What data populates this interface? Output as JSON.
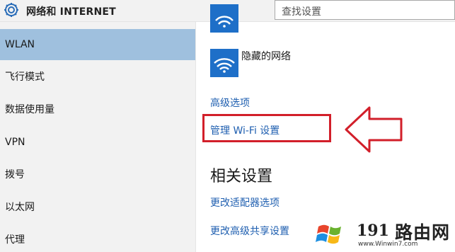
{
  "header": {
    "title": "网络和 INTERNET",
    "search_placeholder": "查找设置"
  },
  "sidebar": {
    "items": [
      {
        "label": "WLAN",
        "active": true
      },
      {
        "label": "飞行模式"
      },
      {
        "label": "数据使用量"
      },
      {
        "label": "VPN"
      },
      {
        "label": "拨号"
      },
      {
        "label": "以太网"
      },
      {
        "label": "代理"
      }
    ]
  },
  "main": {
    "hidden_network_label": "隐藏的网络",
    "advanced_options_link": "高级选项",
    "manage_wifi_link": "管理 Wi-Fi 设置",
    "related_settings_title": "相关设置",
    "adapter_options_link": "更改适配器选项",
    "advanced_sharing_link": "更改高级共享设置"
  },
  "watermark": {
    "number": "191",
    "brand": "路由网",
    "url": "www.Winwin7.com"
  },
  "colors": {
    "accent_blue": "#1e6fc8",
    "active_item": "#9fc0de",
    "highlight_red": "#d21f2a",
    "link": "#1f5fb0"
  }
}
